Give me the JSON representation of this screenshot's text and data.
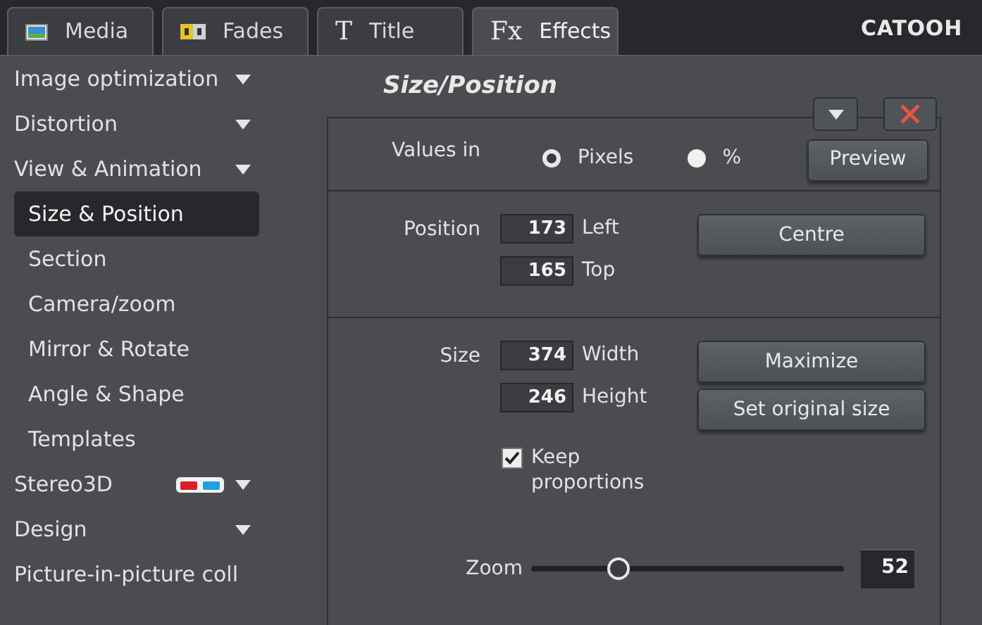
{
  "tabs": [
    {
      "label": "Media",
      "kind": "image",
      "selected": false
    },
    {
      "label": "Fades",
      "kind": "letters",
      "selected": false
    },
    {
      "label": "Title",
      "kind": "symbol",
      "symbol": "T",
      "selected": false
    },
    {
      "label": "Effects",
      "kind": "symbol",
      "symbol": "Fx",
      "selected": true
    }
  ],
  "logo": "CATOOH",
  "sidebar": {
    "items": [
      {
        "label": "Image optimization",
        "kind": "group"
      },
      {
        "label": "Distortion",
        "kind": "group"
      },
      {
        "label": "View & Animation",
        "kind": "group",
        "children": [
          {
            "label": "Size & Position",
            "selected": true
          },
          {
            "label": "Section",
            "selected": false
          },
          {
            "label": "Camera/zoom",
            "selected": false
          },
          {
            "label": "Mirror & Rotate",
            "selected": false
          },
          {
            "label": "Angle & Shape",
            "selected": false
          },
          {
            "label": "Templates",
            "selected": false
          }
        ]
      },
      {
        "label": "Stereo3D",
        "kind": "stereo"
      },
      {
        "label": "Design",
        "kind": "group"
      },
      {
        "label": "Picture-in-picture coll",
        "kind": "plain"
      }
    ]
  },
  "panel": {
    "title": "Size/Position",
    "values_in": {
      "label": "Values in",
      "options": [
        {
          "label": "Pixels",
          "selected": true
        },
        {
          "label": "%",
          "selected": false
        }
      ]
    },
    "preview_button": "Preview",
    "position": {
      "label": "Position",
      "fields": [
        {
          "value": "173",
          "unit": "Left"
        },
        {
          "value": "165",
          "unit": "Top"
        }
      ],
      "buttons": [
        "Centre"
      ]
    },
    "size": {
      "label": "Size",
      "fields": [
        {
          "value": "374",
          "unit": "Width"
        },
        {
          "value": "246",
          "unit": "Height"
        }
      ],
      "buttons": [
        "Maximize",
        "Set original size"
      ]
    },
    "keep_proportions": {
      "label": "Keep proportions",
      "checked": true
    },
    "zoom": {
      "label": "Zoom",
      "level": 0.28,
      "value": "52"
    }
  }
}
